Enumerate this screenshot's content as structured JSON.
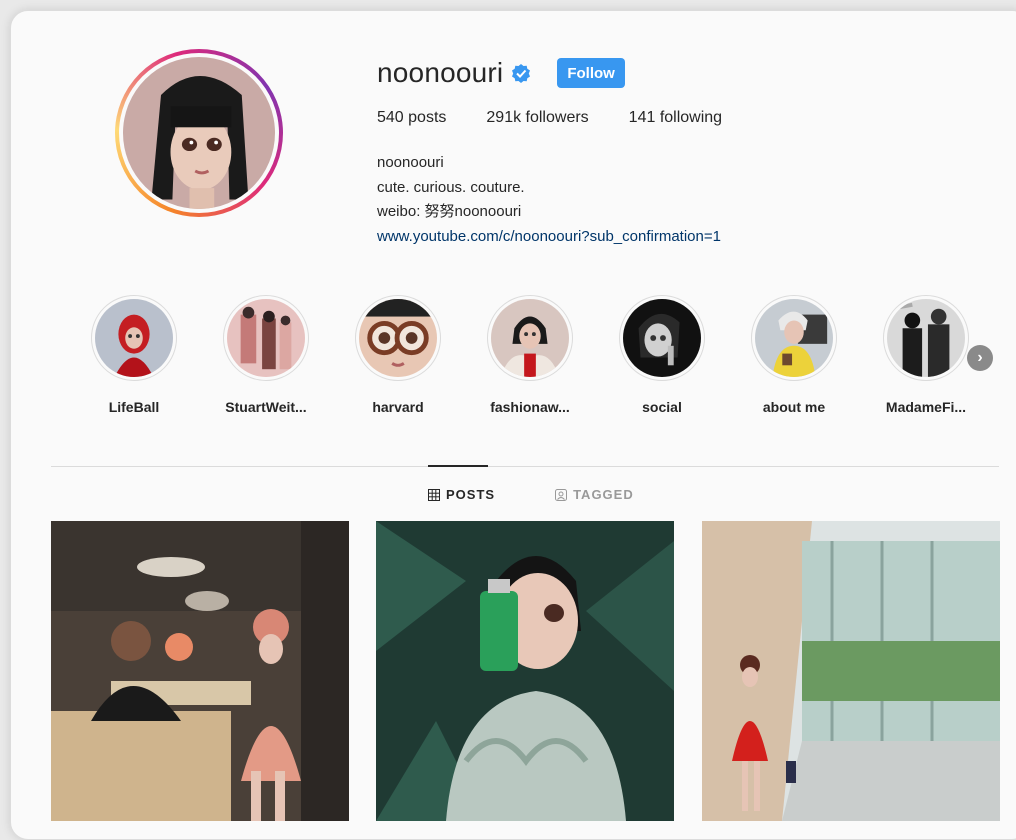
{
  "profile": {
    "username": "noonoouri",
    "follow_label": "Follow",
    "stats": {
      "posts": "540 posts",
      "followers": "291k followers",
      "following": "141 following"
    },
    "bio": {
      "name": "noonoouri",
      "line1": "cute. curious. couture.",
      "line2": "weibo: 努努noonoouri",
      "link": "www.youtube.com/c/noonoouri?sub_confirmation=1"
    }
  },
  "highlights": [
    {
      "label": "LifeBall"
    },
    {
      "label": "StuartWeit..."
    },
    {
      "label": "harvard"
    },
    {
      "label": "fashionaw..."
    },
    {
      "label": "social"
    },
    {
      "label": "about me"
    },
    {
      "label": "MadameFi..."
    }
  ],
  "tabs": {
    "posts": "POSTS",
    "tagged": "TAGGED"
  },
  "icons": {
    "verified": "verified-badge-icon",
    "grid": "grid-icon",
    "tagged": "tagged-person-icon",
    "next": "chevron-right-icon"
  },
  "colors": {
    "follow": "#3897f0",
    "link": "#003569",
    "verified": "#3897f0"
  }
}
